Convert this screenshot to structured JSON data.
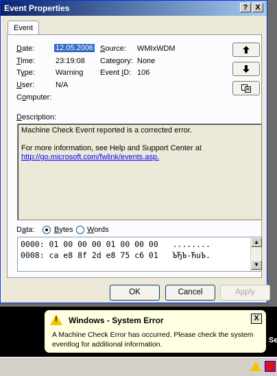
{
  "window": {
    "title": "Event Properties",
    "help_button": "?",
    "close_button": "X"
  },
  "tab": {
    "label": "Event"
  },
  "fields": {
    "date_label": "Date:",
    "date_value": "12.05.2006",
    "time_label": "Time:",
    "time_value": "23:19:08",
    "type_label": "Type:",
    "type_value": "Warning",
    "user_label": "User:",
    "user_value": "N/A",
    "computer_label": "Computer:",
    "source_label": "Source:",
    "source_value": "WMIxWDM",
    "category_label": "Category:",
    "category_value": "None",
    "event_id_label": "Event ID:",
    "event_id_value": "106"
  },
  "nav_buttons": {
    "up_icon": "arrow-up-icon",
    "down_icon": "arrow-down-icon",
    "copy_icon": "copy-icon"
  },
  "description": {
    "label": "Description:",
    "line1": "Machine Check Event reported is a corrected error.",
    "line2": "For more information, see Help and Support Center at",
    "link": "http://go.microsoft.com/fwlink/events.asp."
  },
  "data": {
    "label": "Data:",
    "bytes_label": "Bytes",
    "words_label": "Words",
    "selected": "Bytes",
    "hex_line1": "0000: 01 00 00 00 01 00 00 00   ........",
    "hex_line2": "0008: ca e8 8f 2d e8 75 c6 01   ЪЂЪ-ЋuЪ."
  },
  "buttons": {
    "ok": "OK",
    "cancel": "Cancel",
    "apply": "Apply"
  },
  "balloon": {
    "title": "Windows - System Error",
    "close": "X",
    "message_line1": "A Machine Check Error has occurred. Please check the system",
    "message_line2": "eventlog for additional information."
  },
  "colors": {
    "titlebar_start": "#0a246a",
    "titlebar_end": "#a6caf0",
    "dialog_bg": "#ece9d8",
    "selection": "#316ac5",
    "balloon_bg": "#ffffe1",
    "warning": "#f5c400"
  }
}
